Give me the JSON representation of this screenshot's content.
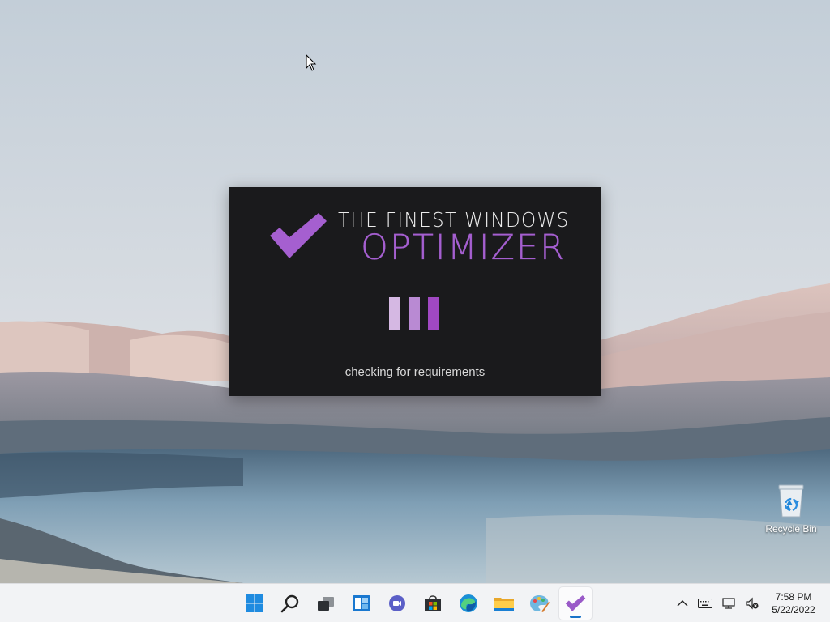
{
  "splash": {
    "title_line1": "THE FINEST WINDOWS",
    "title_line2": "OPTIMIZER",
    "status": "checking for requirements",
    "accent_color": "#a55fd0",
    "background_color": "#1a1a1c",
    "loading_bars": [
      "#d5b8e3",
      "#b98ad3",
      "#a048c2"
    ]
  },
  "desktop": {
    "icons": [
      {
        "name": "recycle-bin",
        "label": "Recycle Bin",
        "icon": "recycle-bin-icon"
      }
    ]
  },
  "taskbar": {
    "apps": [
      {
        "name": "start",
        "icon": "windows-logo-icon",
        "active": false
      },
      {
        "name": "search",
        "icon": "search-icon",
        "active": false
      },
      {
        "name": "task-view",
        "icon": "task-view-icon",
        "active": false
      },
      {
        "name": "widgets",
        "icon": "widgets-icon",
        "active": false
      },
      {
        "name": "chat",
        "icon": "chat-icon",
        "active": false
      },
      {
        "name": "store",
        "icon": "store-icon",
        "active": false
      },
      {
        "name": "edge",
        "icon": "edge-icon",
        "active": false
      },
      {
        "name": "file-explorer",
        "icon": "folder-icon",
        "active": false
      },
      {
        "name": "paint",
        "icon": "paint-icon",
        "active": false
      },
      {
        "name": "optimizer",
        "icon": "checkmark-icon",
        "active": true
      }
    ],
    "tray": {
      "icons": [
        "chevron-up-icon",
        "keyboard-icon",
        "network-icon",
        "volume-muted-icon"
      ],
      "time": "7:58 PM",
      "date": "5/22/2022"
    }
  }
}
